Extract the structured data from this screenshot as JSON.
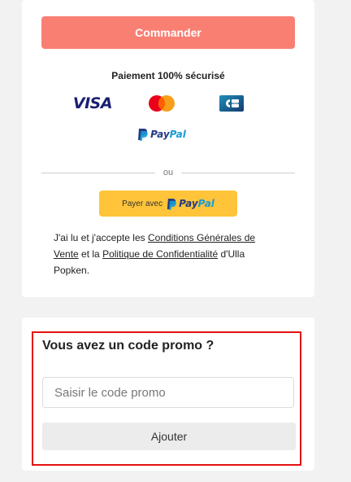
{
  "checkout": {
    "order_button_label": "Commander",
    "secure_payment_label": "Paiement 100% sécurisé",
    "payment_methods": {
      "visa": "VISA",
      "mastercard": "Mastercard",
      "cb": "CB",
      "paypal_pay": "Pay",
      "paypal_pal": "Pal"
    },
    "divider_label": "ou",
    "paypal_button": {
      "prefix": "Payer avec",
      "brand_pay": "Pay",
      "brand_pal": "Pal"
    },
    "terms": {
      "part1": "J'ai lu et j'accepte les ",
      "cgv_link": "Conditions Générales de Vente",
      "part2": " et la ",
      "privacy_link": "Politique de Confidentialité",
      "part3": " d'Ulla Popken."
    }
  },
  "promo": {
    "title": "Vous avez un code promo ?",
    "input_placeholder": "Saisir le code promo",
    "input_value": "",
    "add_button_label": "Ajouter"
  },
  "colors": {
    "order_button": "#f97f73",
    "paypal_yellow": "#ffc439",
    "paypal_dark_blue": "#253b80",
    "paypal_light_blue": "#179bd7",
    "visa_blue": "#1a1f71",
    "highlight_border": "#e41111"
  }
}
